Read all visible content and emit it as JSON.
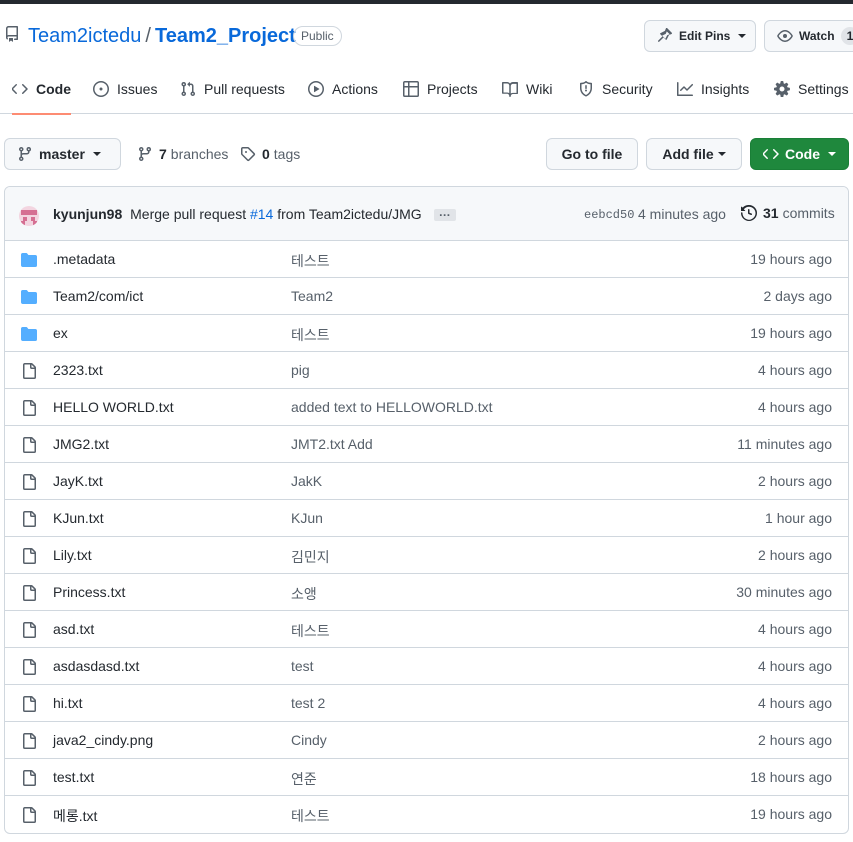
{
  "colors": {
    "link": "#0969da",
    "folder_icon": "#54aeff",
    "primary_button": "#1f883d",
    "tab_underline": "#fd8c73"
  },
  "repo": {
    "icon": "repo-icon",
    "owner": "Team2ictedu",
    "separator": "/",
    "name": "Team2_Project",
    "visibility": "Public"
  },
  "header_actions": {
    "edit_pins": "Edit Pins",
    "watch": "Watch",
    "watch_count": "1"
  },
  "tabs": [
    {
      "label": "Code",
      "icon": "code-icon",
      "active": true
    },
    {
      "label": "Issues",
      "icon": "issue-opened-icon"
    },
    {
      "label": "Pull requests",
      "icon": "git-pull-request-icon"
    },
    {
      "label": "Actions",
      "icon": "play-icon"
    },
    {
      "label": "Projects",
      "icon": "table-icon"
    },
    {
      "label": "Wiki",
      "icon": "book-icon"
    },
    {
      "label": "Security",
      "icon": "shield-icon"
    },
    {
      "label": "Insights",
      "icon": "graph-icon"
    },
    {
      "label": "Settings",
      "icon": "gear-icon"
    }
  ],
  "toolbar": {
    "branch": "master",
    "branch_count": "7",
    "branches_label": "branches",
    "tag_count": "0",
    "tags_label": "tags",
    "goto_file": "Go to file",
    "add_file": "Add file",
    "code": "Code"
  },
  "latest_commit": {
    "author": "kyunjun98",
    "message_prefix": "Merge pull request",
    "pr_number": "#14",
    "message_suffix": "from Team2ictedu/JMG",
    "ellipsis": "…",
    "sha": "eebcd50",
    "time": "4 minutes ago",
    "commit_count": "31",
    "commits_label": "commits"
  },
  "files": [
    {
      "type": "dir",
      "name": ".metadata",
      "message": "테스트",
      "age": "19 hours ago"
    },
    {
      "type": "dir",
      "name": "Team2/com/ict",
      "message": "Team2",
      "age": "2 days ago"
    },
    {
      "type": "dir",
      "name": "ex",
      "message": "테스트",
      "age": "19 hours ago"
    },
    {
      "type": "file",
      "name": "2323.txt",
      "message": "pig",
      "age": "4 hours ago"
    },
    {
      "type": "file",
      "name": "HELLO WORLD.txt",
      "message": "added text to HELLOWORLD.txt",
      "age": "4 hours ago"
    },
    {
      "type": "file",
      "name": "JMG2.txt",
      "message": "JMT2.txt Add",
      "age": "11 minutes ago"
    },
    {
      "type": "file",
      "name": "JayK.txt",
      "message": "JakK",
      "age": "2 hours ago"
    },
    {
      "type": "file",
      "name": "KJun.txt",
      "message": "KJun",
      "age": "1 hour ago"
    },
    {
      "type": "file",
      "name": "Lily.txt",
      "message": "김민지",
      "age": "2 hours ago"
    },
    {
      "type": "file",
      "name": "Princess.txt",
      "message": "소앵",
      "age": "30 minutes ago"
    },
    {
      "type": "file",
      "name": "asd.txt",
      "message": "테스트",
      "age": "4 hours ago"
    },
    {
      "type": "file",
      "name": "asdasdasd.txt",
      "message": "test",
      "age": "4 hours ago"
    },
    {
      "type": "file",
      "name": "hi.txt",
      "message": "test 2",
      "age": "4 hours ago"
    },
    {
      "type": "file",
      "name": "java2_cindy.png",
      "message": "Cindy",
      "age": "2 hours ago"
    },
    {
      "type": "file",
      "name": "test.txt",
      "message": "연준",
      "age": "18 hours ago"
    },
    {
      "type": "file",
      "name": "메롱.txt",
      "message": "테스트",
      "age": "19 hours ago"
    }
  ]
}
